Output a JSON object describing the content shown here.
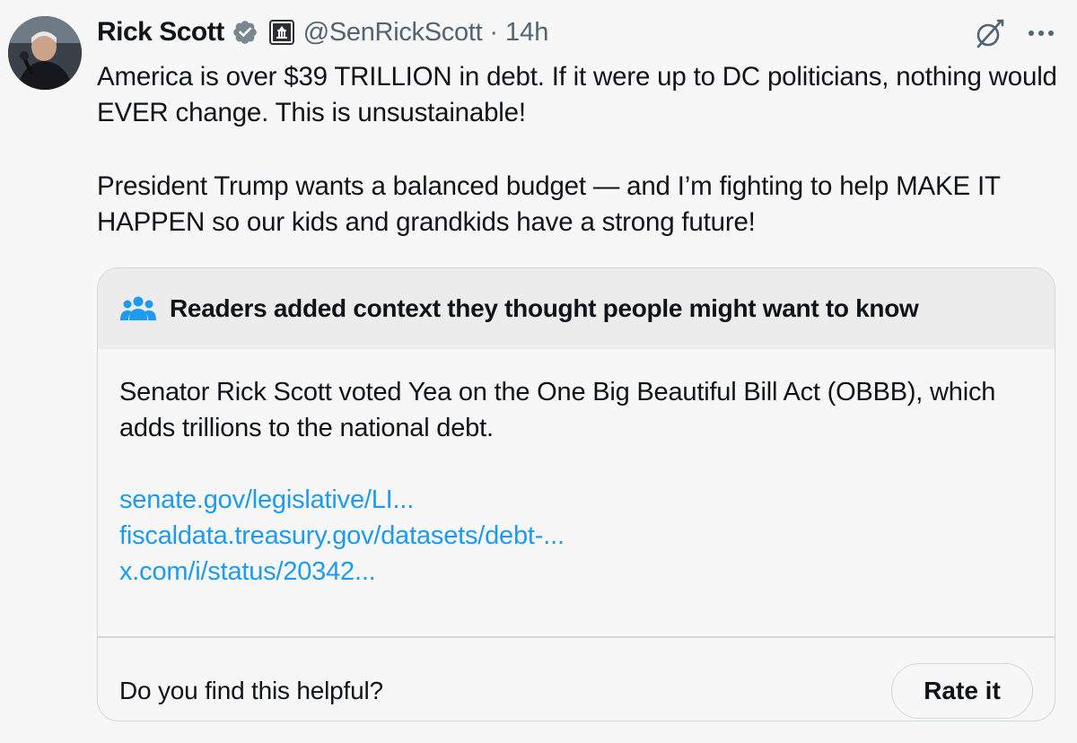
{
  "colors": {
    "background": "#f7f7f7",
    "text": "#0f1419",
    "muted": "#536471",
    "link": "#1d9bf0",
    "verified": "#7a8690",
    "note_header_bg": "#ececec",
    "border": "#cfd9de"
  },
  "icons": {
    "avatar": "avatar",
    "verified": "verified-badge-icon",
    "affiliation": "capitol-building-icon",
    "grok": "grok-slash-icon",
    "more": "more-dots-icon",
    "people": "people-group-icon"
  },
  "tweet": {
    "author_name": "Rick Scott",
    "handle": "@SenRickScott",
    "separator": "·",
    "time": "14h",
    "text_paragraphs": [
      "America is over $39 TRILLION in debt. If it were up to DC politicians, nothing would EVER change. This is unsustainable!",
      "President Trump wants a balanced budget — and I’m fighting to help MAKE IT HAPPEN so our kids and grandkids have a strong future!"
    ]
  },
  "community_note": {
    "title": "Readers added context they thought people might want to know",
    "text": "Senator Rick Scott voted Yea on the One Big Beautiful Bill Act (OBBB), which adds trillions to the national debt.",
    "links": [
      "senate.gov/legislative/LI...",
      "fiscaldata.treasury.gov/datasets/debt-...",
      "x.com/i/status/20342..."
    ],
    "helpful_prompt": "Do you find this helpful?",
    "rate_label": "Rate it"
  }
}
